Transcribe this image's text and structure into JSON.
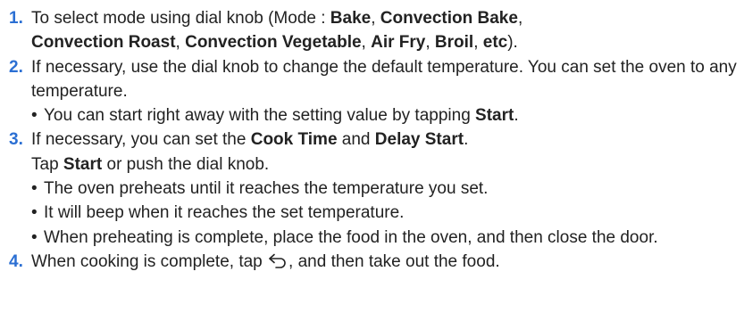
{
  "steps": [
    {
      "number": "1.",
      "line1": {
        "prefix": "To select mode using dial knob (Mode : ",
        "mode1": "Bake",
        "sep1": ", ",
        "mode2": "Convection Bake",
        "sep2": ","
      },
      "line2": {
        "mode3": "Convection Roast",
        "sep3": ", ",
        "mode4": "Convection Vegetable",
        "sep4": ", ",
        "mode5": "Air Fry",
        "sep5": ", ",
        "mode6": "Broil",
        "sep6": ", ",
        "mode7": "etc",
        "suffix": ")."
      }
    },
    {
      "number": "2.",
      "text": "If necessary, use the dial knob to change the default temperature. You can set the oven to any temperature.",
      "bullet": {
        "prefix": "You can start right away with the setting value by tapping ",
        "button": "Start",
        "suffix": "."
      }
    },
    {
      "number": "3.",
      "line1": {
        "prefix": "If necessary, you can set the ",
        "opt1": "Cook Time",
        "mid": " and ",
        "opt2": "Delay Start",
        "suffix": "."
      },
      "line2": {
        "prefix": "Tap ",
        "button": "Start",
        "suffix": " or push the dial knob."
      },
      "bullets": [
        "The oven preheats until it reaches the temperature you set.",
        "It will beep when it reaches the set temperature.",
        "When preheating is complete, place the food in the oven, and then close the door."
      ]
    },
    {
      "number": "4.",
      "prefix": "When cooking is complete, tap ",
      "icon": "back-icon",
      "suffix": ", and then take out the food."
    }
  ]
}
